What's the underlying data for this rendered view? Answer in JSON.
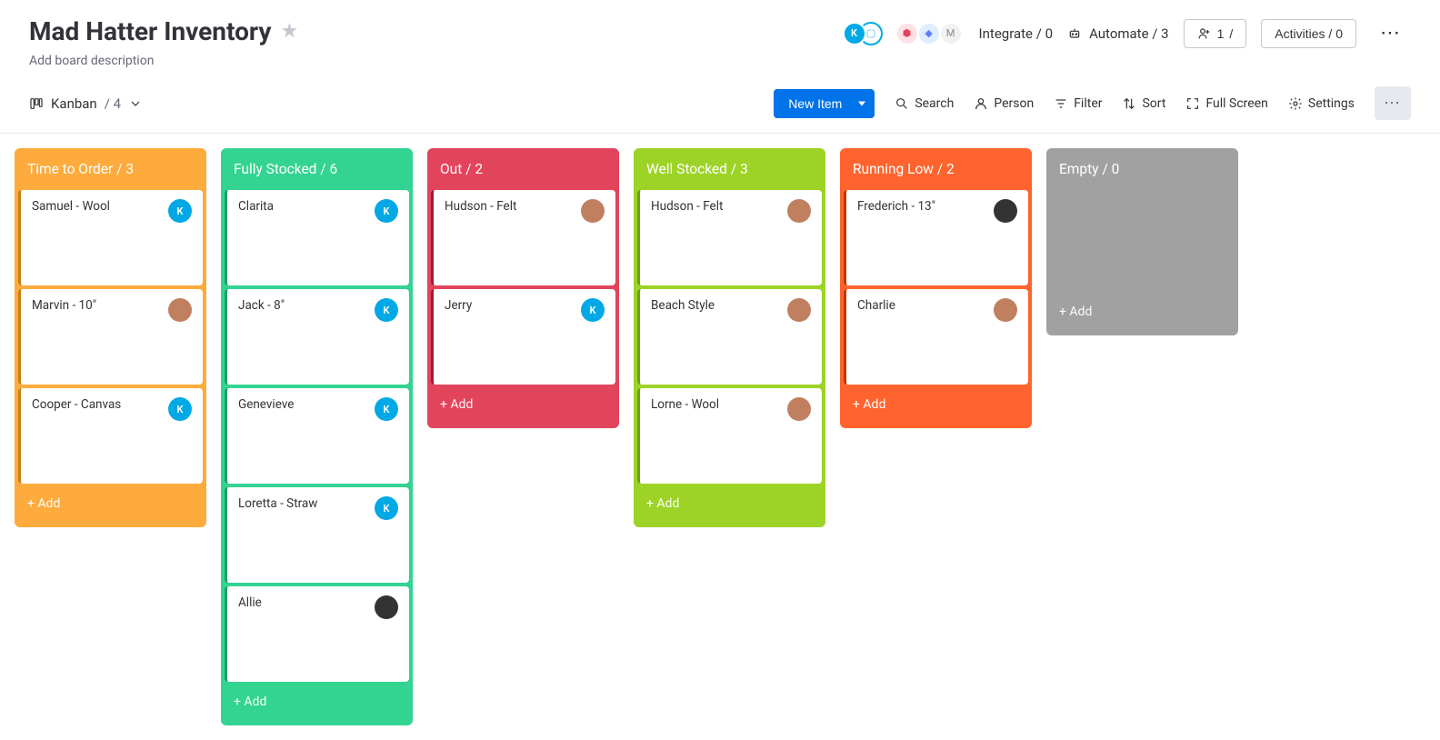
{
  "header": {
    "title": "Mad Hatter Inventory",
    "description_prompt": "Add board description",
    "integrate_label": "Integrate / 0",
    "automate_label": "Automate / 3",
    "members_label": "1",
    "activities_label": "Activities / 0",
    "avatar_letter": "K"
  },
  "toolbar": {
    "view_label": "Kanban",
    "view_count": "/ 4",
    "new_item": "New Item",
    "search": "Search",
    "person": "Person",
    "filter": "Filter",
    "sort": "Sort",
    "fullscreen": "Full Screen",
    "settings": "Settings"
  },
  "columns": [
    {
      "title": "Time to Order / 3",
      "color": "c-orange",
      "add": "+ Add",
      "cards": [
        {
          "title": "Samuel - Wool",
          "avatar": "K",
          "atype": "av-blue"
        },
        {
          "title": "Marvin - 10\"",
          "avatar": "",
          "atype": "av-photo"
        },
        {
          "title": "Cooper - Canvas",
          "avatar": "K",
          "atype": "av-blue"
        }
      ]
    },
    {
      "title": "Fully Stocked / 6",
      "color": "c-green",
      "add": "+ Add",
      "cards": [
        {
          "title": "Clarita",
          "avatar": "K",
          "atype": "av-blue"
        },
        {
          "title": "Jack - 8\"",
          "avatar": "K",
          "atype": "av-blue"
        },
        {
          "title": "Genevieve",
          "avatar": "K",
          "atype": "av-blue"
        },
        {
          "title": "Loretta - Straw",
          "avatar": "K",
          "atype": "av-blue"
        },
        {
          "title": "Allie",
          "avatar": "",
          "atype": "av-photo2"
        }
      ]
    },
    {
      "title": "Out / 2",
      "color": "c-pink",
      "add": "+ Add",
      "cards": [
        {
          "title": "Hudson - Felt",
          "avatar": "",
          "atype": "av-photo"
        },
        {
          "title": "Jerry",
          "avatar": "K",
          "atype": "av-blue"
        }
      ]
    },
    {
      "title": "Well Stocked / 3",
      "color": "c-lime",
      "add": "+ Add",
      "cards": [
        {
          "title": "Hudson - Felt",
          "avatar": "",
          "atype": "av-photo"
        },
        {
          "title": "Beach Style",
          "avatar": "",
          "atype": "av-photo"
        },
        {
          "title": "Lorne - Wool",
          "avatar": "",
          "atype": "av-photo"
        }
      ]
    },
    {
      "title": "Running Low / 2",
      "color": "c-red",
      "add": "+ Add",
      "cards": [
        {
          "title": "Frederich - 13\"",
          "avatar": "",
          "atype": "av-photo2"
        },
        {
          "title": "Charlie",
          "avatar": "",
          "atype": "av-photo"
        }
      ]
    },
    {
      "title": "Empty / 0",
      "color": "c-grey",
      "add": "+ Add",
      "empty": true,
      "cards": []
    }
  ]
}
